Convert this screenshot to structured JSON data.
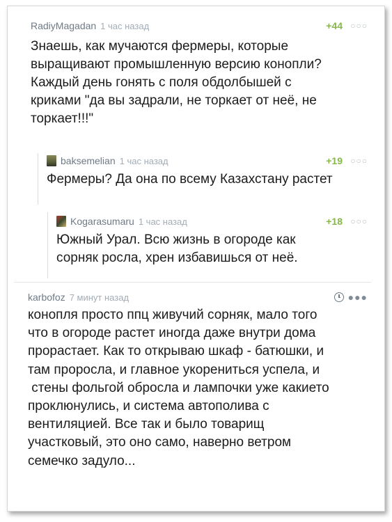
{
  "comments": [
    {
      "username": "RadiyMagadan",
      "time": "1 час назад",
      "rating": "+44",
      "more": "○○○",
      "lines": [
        "Знаешь, как мучаются фермеры, которые",
        "выращивают промышленную версию конопли?",
        "Каждый день гонять с поля обдолбышей с",
        "криками \"да вы задрали, не торкает от неё, не",
        "торкает!!!\""
      ]
    },
    {
      "username": "baksemelian",
      "time": "1 час назад",
      "rating": "+19",
      "more": "○○○",
      "lines": [
        "Фермеры? Да она по всему Казахстану растет"
      ]
    },
    {
      "username": "Kogarasumaru",
      "time": "1 час назад",
      "rating": "+18",
      "more": "○○○",
      "lines": [
        "Южный Урал. Всю жизнь в огороде как",
        "сорняк росла, хрен избавишься от неё."
      ]
    },
    {
      "username": "karbofoz",
      "time": "7 минут назад",
      "more": "●●●",
      "lines": [
        "конопля просто ппц живучий сорняк, мало того",
        "что в огороде растет иногда даже внутри дома",
        "прорастает. Как то открываю шкаф - батюшки, и",
        "там проросла, и главное укорениться успела, и",
        " стены фольгой обросла и лампочки уже какието",
        "проклюнулись, и система автополива с",
        "вентиляцией. Все так и было товарищ",
        "участковый, это оно само, наверно ветром",
        "семечко задуло..."
      ]
    }
  ]
}
